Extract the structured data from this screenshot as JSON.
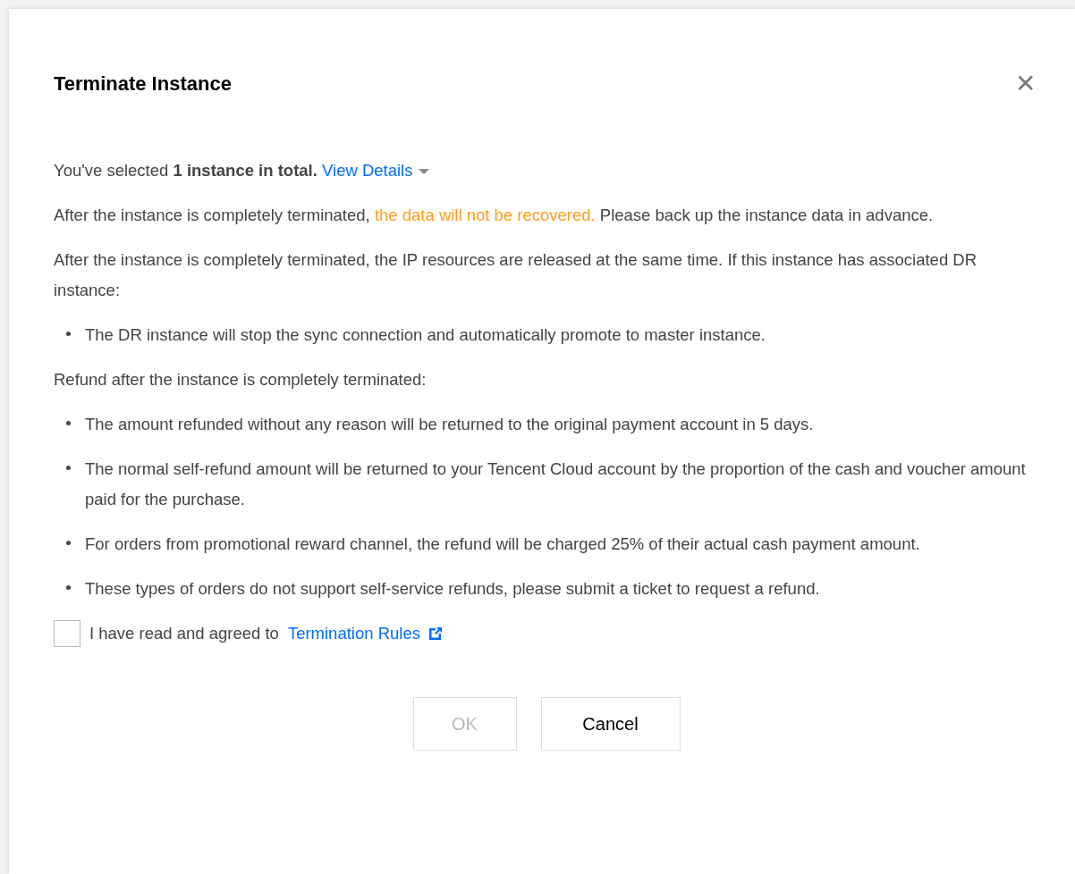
{
  "dialog": {
    "title": "Terminate Instance",
    "close": "✕"
  },
  "summary": {
    "text": "You've selected **1 instance in total.**",
    "link": "View Details",
    "expanded": false
  },
  "paragraphs": [
    {
      "parts": [
        {
          "kind": "plain",
          "text": "After the instance is completely terminated, "
        },
        {
          "kind": "warning",
          "text": "the data will not be recovered."
        },
        {
          "kind": "plain",
          "text": " Please back up the instance data in advance."
        }
      ]
    },
    {
      "parts": [
        {
          "kind": "plain",
          "text": "After the instance is completely terminated, the IP resources are released at the same time. If this instance has associated DR instance:"
        }
      ],
      "bullets": [
        "The DR instance will stop the sync connection and automatically promote to master instance."
      ]
    },
    {
      "parts": [
        {
          "kind": "plain",
          "text": "Refund after the instance is completely terminated:"
        }
      ],
      "bullets": [
        "The amount refunded without any reason will be returned to the original payment account in 5 days.",
        "The normal self-refund amount will be returned to your Tencent Cloud account by the proportion of the cash and voucher amount paid for the purchase.",
        "For orders from promotional reward channel, the refund will be charged 25% of their actual cash payment amount.",
        "These types of orders do not support self-service refunds, please submit a ticket to request a refund."
      ]
    }
  ],
  "agreement": {
    "label": "I have read and agreed to",
    "link": "Termination Rules",
    "checked": false
  },
  "buttons": [
    {
      "label": "OK",
      "kind": "primary",
      "disabled": true
    },
    {
      "label": "Cancel",
      "kind": "secondary",
      "disabled": false
    }
  ]
}
